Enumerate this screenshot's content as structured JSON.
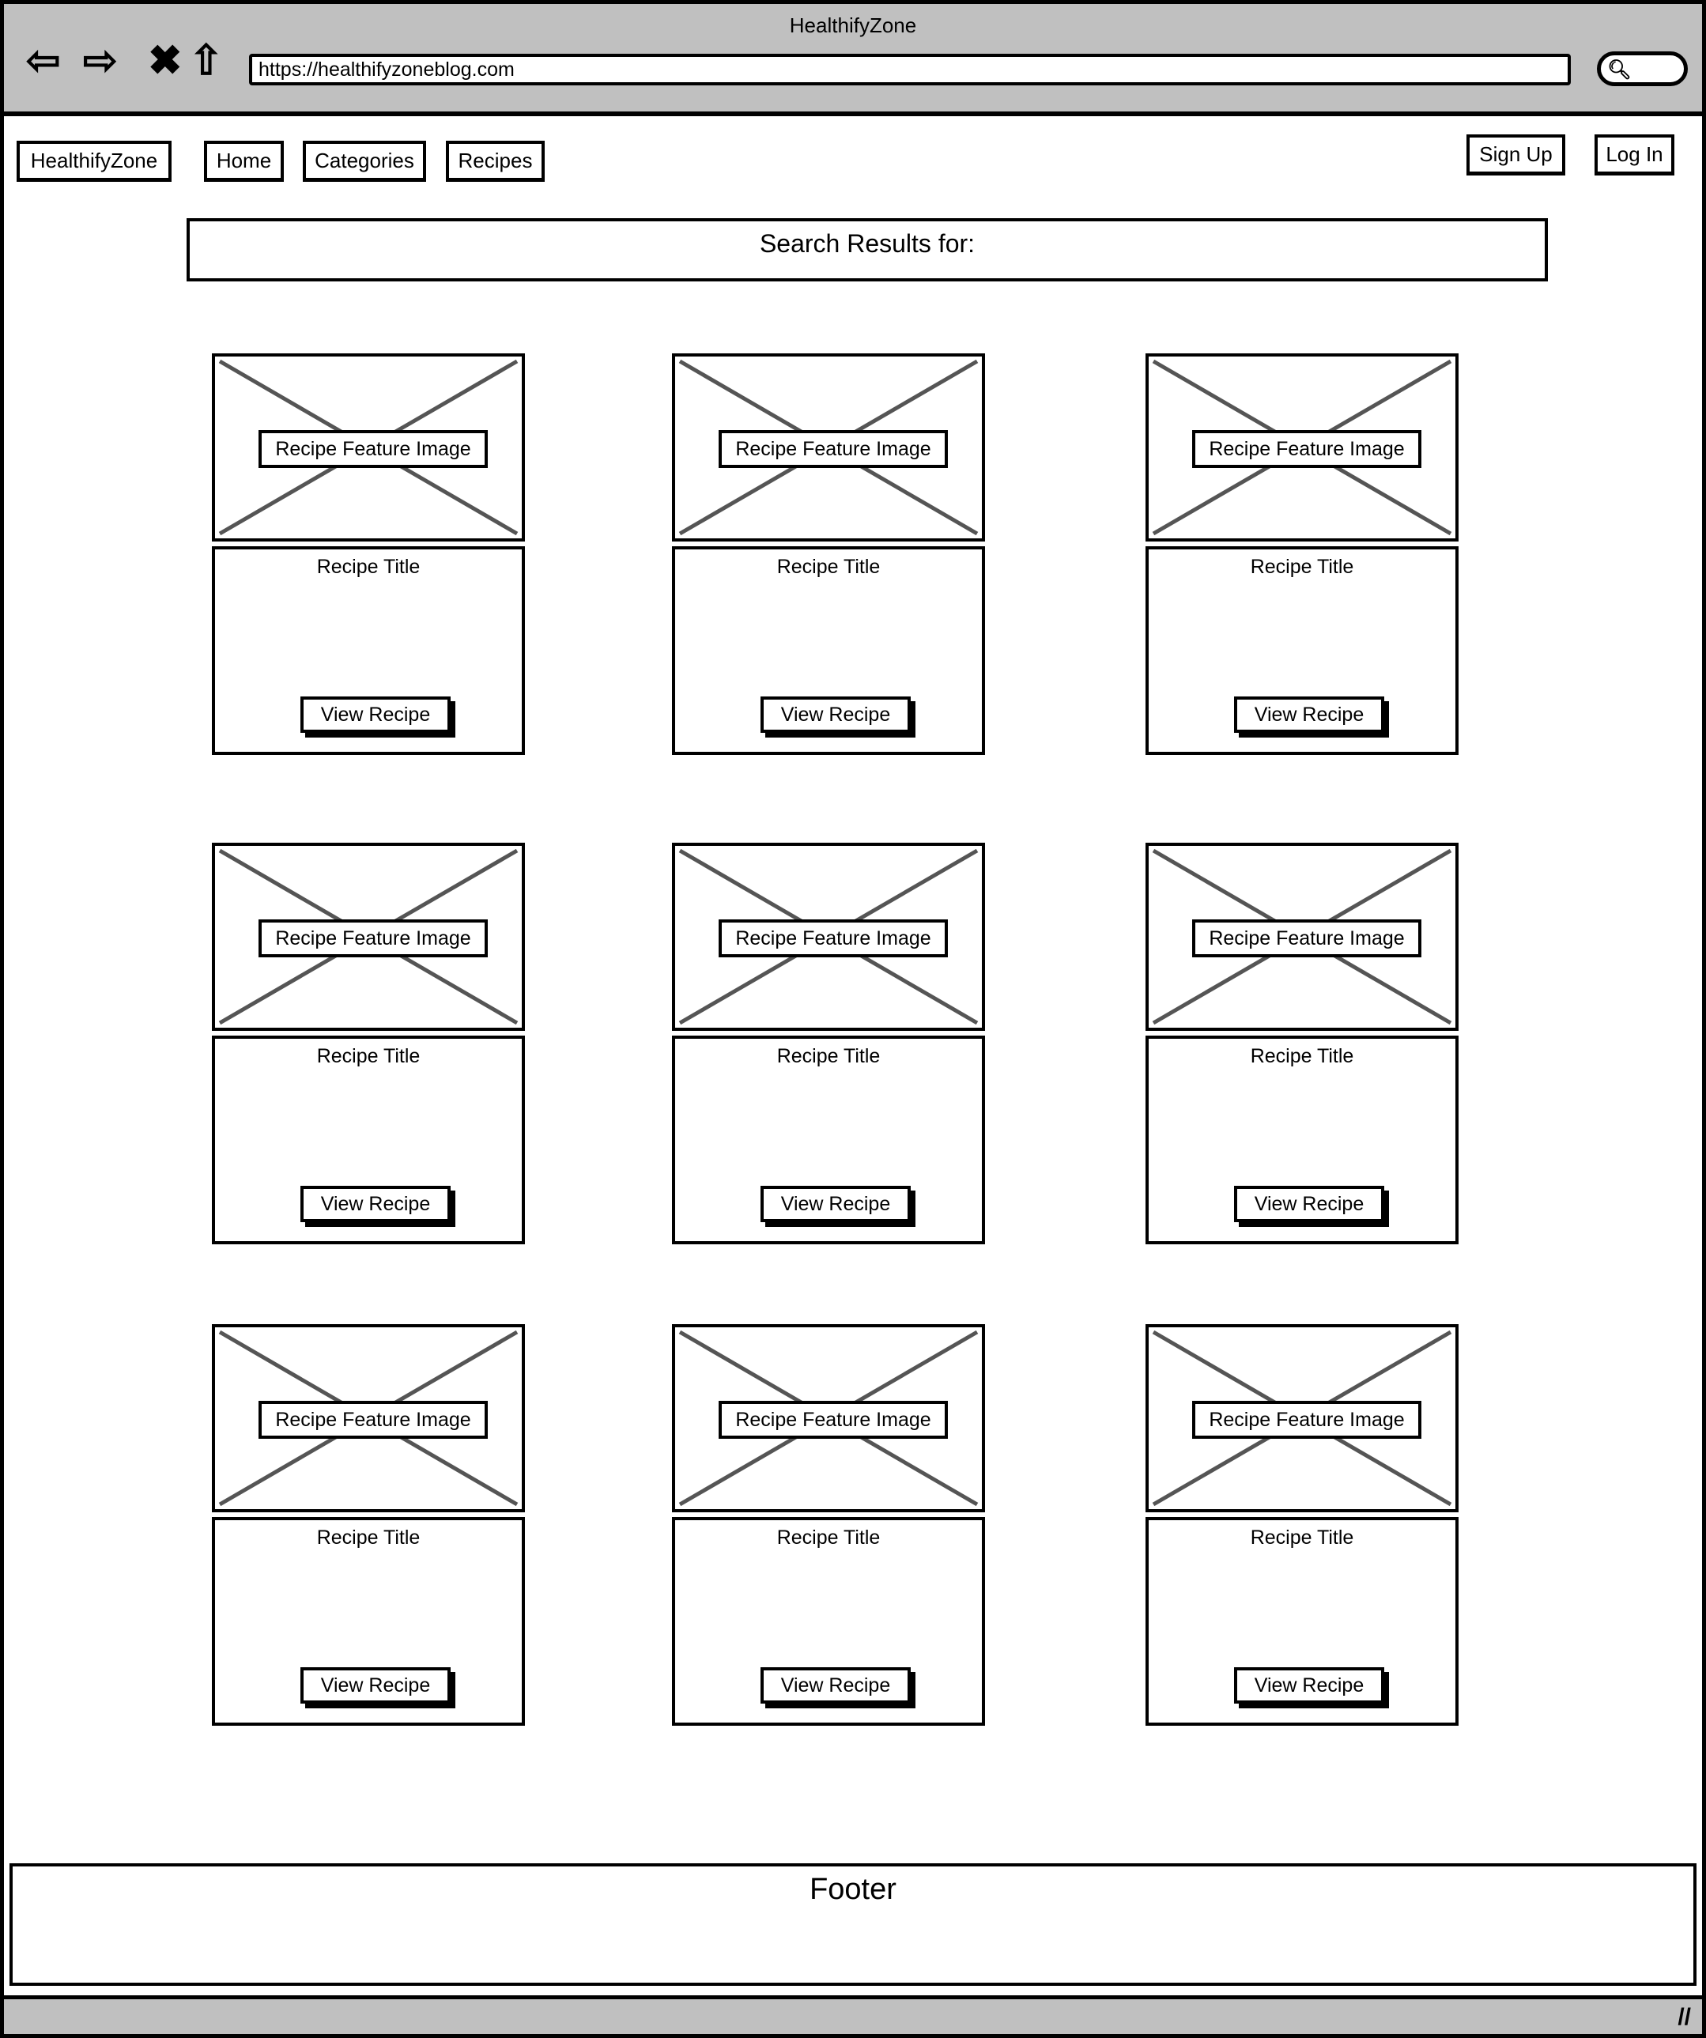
{
  "browser": {
    "title": "HealthifyZone",
    "url": "https://healthifyzoneblog.com"
  },
  "nav": {
    "logo": "HealthifyZone",
    "home": "Home",
    "categories": "Categories",
    "recipes": "Recipes",
    "signup": "Sign Up",
    "login": "Log In"
  },
  "search": {
    "heading": "Search Results for:"
  },
  "cards": [
    {
      "image": "Recipe Feature Image",
      "title": "Recipe Title",
      "button": "View Recipe"
    },
    {
      "image": "Recipe Feature Image",
      "title": "Recipe Title",
      "button": "View Recipe"
    },
    {
      "image": "Recipe Feature Image",
      "title": "Recipe Title",
      "button": "View Recipe"
    },
    {
      "image": "Recipe Feature Image",
      "title": "Recipe Title",
      "button": "View Recipe"
    },
    {
      "image": "Recipe Feature Image",
      "title": "Recipe Title",
      "button": "View Recipe"
    },
    {
      "image": "Recipe Feature Image",
      "title": "Recipe Title",
      "button": "View Recipe"
    },
    {
      "image": "Recipe Feature Image",
      "title": "Recipe Title",
      "button": "View Recipe"
    },
    {
      "image": "Recipe Feature Image",
      "title": "Recipe Title",
      "button": "View Recipe"
    },
    {
      "image": "Recipe Feature Image",
      "title": "Recipe Title",
      "button": "View Recipe"
    }
  ],
  "footer": {
    "label": "Footer"
  }
}
